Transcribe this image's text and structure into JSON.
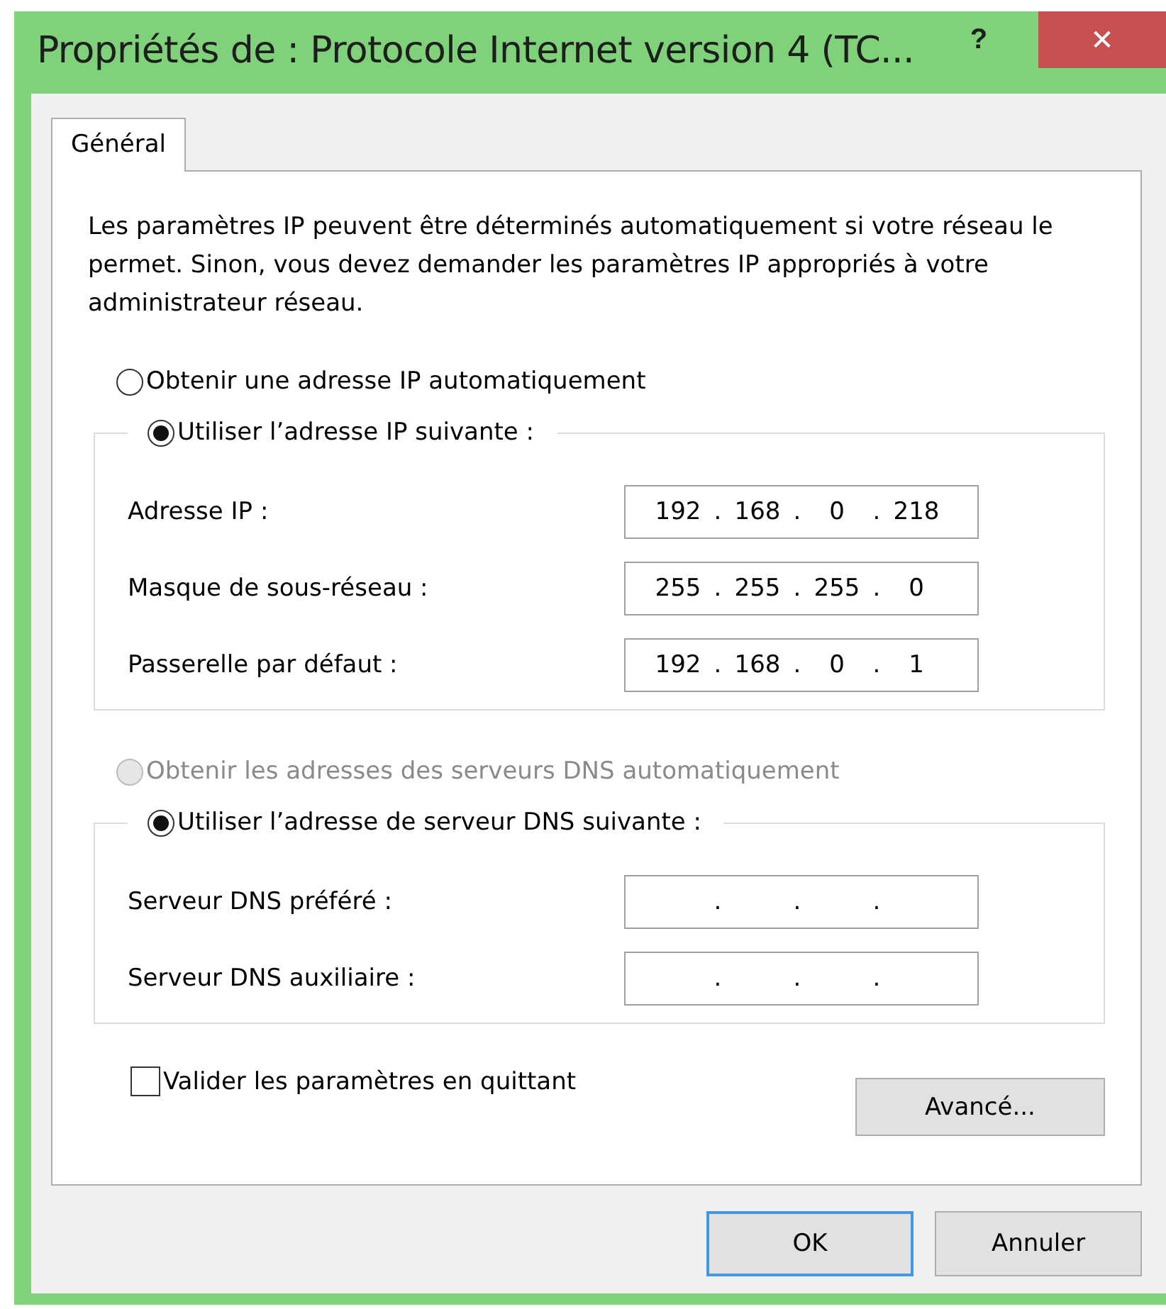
{
  "window": {
    "title": "Propriétés de : Protocole Internet version 4 (TC...",
    "help": "?",
    "close": "✕"
  },
  "tabs": [
    {
      "label": "Général",
      "selected": true
    }
  ],
  "description": "Les paramètres IP peuvent être déterminés automatiquement si votre réseau le permet. Sinon, vous devez demander les paramètres IP appropriés à votre administrateur réseau.",
  "ip_section": {
    "auto_option": {
      "label": "Obtenir une adresse IP automatiquement",
      "selected": false,
      "disabled": false
    },
    "manual_option": {
      "label": "Utiliser l’adresse IP suivante :",
      "selected": true,
      "disabled": false
    },
    "fields": [
      {
        "label": "Adresse IP :",
        "separator": ".",
        "octets": [
          "192",
          "168",
          "0",
          "218"
        ]
      },
      {
        "label": "Masque de sous-réseau :",
        "separator": ".",
        "octets": [
          "255",
          "255",
          "255",
          "0"
        ]
      },
      {
        "label": "Passerelle par défaut :",
        "separator": ".",
        "octets": [
          "192",
          "168",
          "0",
          "1"
        ]
      }
    ]
  },
  "dns_section": {
    "auto_option": {
      "label": "Obtenir les adresses des serveurs DNS automatiquement",
      "selected": false,
      "disabled": true
    },
    "manual_option": {
      "label": "Utiliser l’adresse de serveur DNS suivante :",
      "selected": true,
      "disabled": false
    },
    "fields": [
      {
        "label": "Serveur DNS préféré :",
        "separator": "."
      },
      {
        "label": "Serveur DNS auxiliaire :",
        "separator": "."
      }
    ]
  },
  "validate_checkbox": {
    "label": "Valider les paramètres en quittant",
    "checked": false
  },
  "advanced_button": "Avancé...",
  "buttons": [
    {
      "label": "OK",
      "default": true
    },
    {
      "label": "Annuler",
      "default": false
    }
  ]
}
